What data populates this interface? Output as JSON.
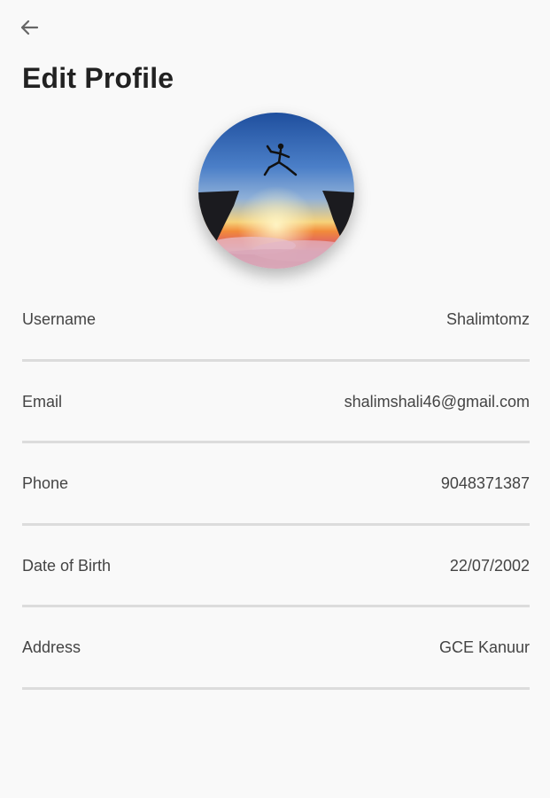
{
  "header": {
    "back_icon": "arrow-left-icon",
    "title": "Edit Profile"
  },
  "avatar": {
    "image": "profile-photo-sunset-jump"
  },
  "fields": [
    {
      "label": "Username",
      "value": "Shalimtomz"
    },
    {
      "label": "Email",
      "value": "shalimshali46@gmail.com"
    },
    {
      "label": "Phone",
      "value": "9048371387"
    },
    {
      "label": "Date of Birth",
      "value": "22/07/2002"
    },
    {
      "label": "Address",
      "value": "GCE Kanuur"
    }
  ],
  "colors": {
    "background": "#f9f9f9",
    "divider": "#dcdcdc",
    "text": "#444444"
  }
}
